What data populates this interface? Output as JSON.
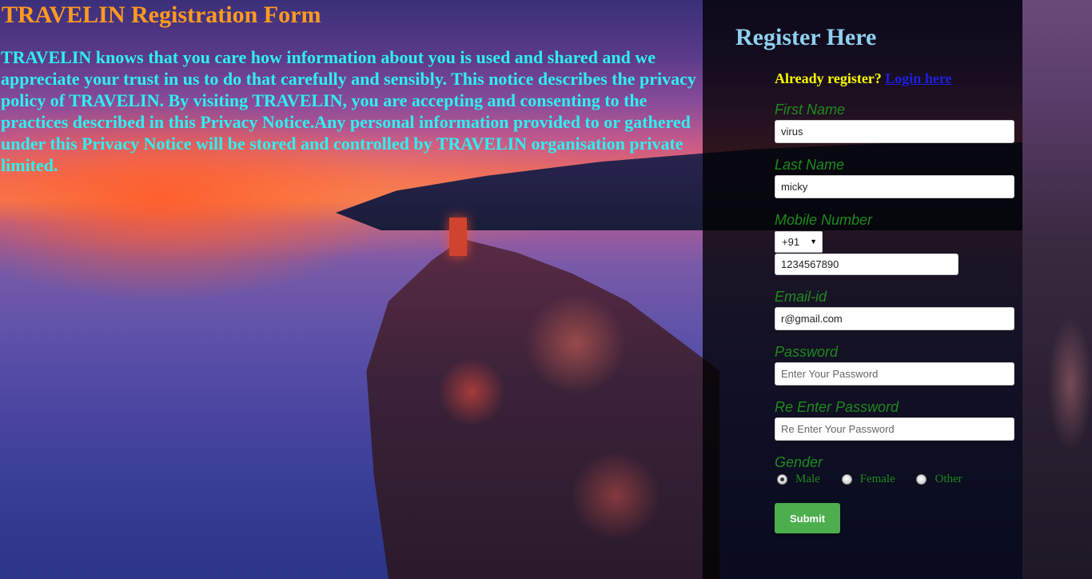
{
  "page": {
    "title": "TRAVELIN Registration Form",
    "intro": "TRAVELIN knows that you care how information about you is used and shared and we appreciate your trust in us to do that carefully and sensibly. This notice describes the privacy policy of TRAVELIN. By visiting TRAVELIN, you are accepting and consenting to the practices described in this Privacy Notice.Any personal information provided to or gathered under this Privacy Notice will be stored and controlled by TRAVELIN organisation private limited."
  },
  "form": {
    "heading": "Register Here",
    "already_text": "Already register?",
    "login_link": "Login here",
    "first_name": {
      "label": "First Name",
      "value": "virus"
    },
    "last_name": {
      "label": "Last Name",
      "value": "micky"
    },
    "mobile": {
      "label": "Mobile Number",
      "country_code": "+91",
      "value": "1234567890"
    },
    "email": {
      "label": "Email-id",
      "value": "r@gmail.com"
    },
    "password": {
      "label": "Password",
      "value": "",
      "placeholder": "Enter Your Password"
    },
    "re_password": {
      "label": "Re Enter Password",
      "value": "",
      "placeholder": "Re Enter Your Password"
    },
    "gender": {
      "label": "Gender",
      "options": [
        "Male",
        "Female",
        "Other"
      ],
      "selected": "Male"
    },
    "submit_label": "Submit"
  },
  "colors": {
    "title": "#ff9a1e",
    "intro": "#2ef0f0",
    "panel_heading": "#8fd0f0",
    "already": "#ffff00",
    "link": "#1e1ee0",
    "label": "#1e8a1e",
    "submit": "#4cae4c"
  }
}
